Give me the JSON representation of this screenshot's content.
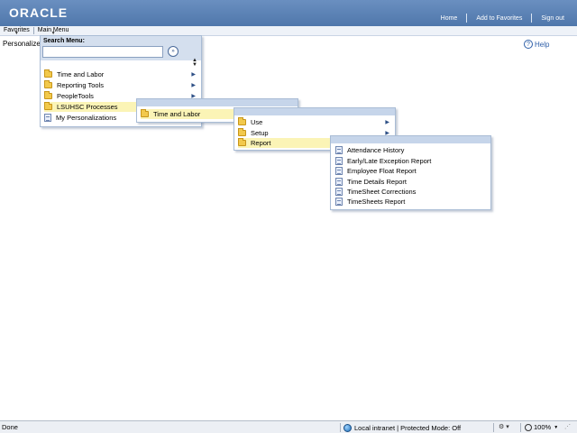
{
  "header": {
    "logo_text": "ORACLE",
    "links": [
      "Home",
      "Add to Favorites",
      "Sign out"
    ],
    "bg_color": "#5b80b4"
  },
  "menubar": {
    "items": [
      "Favorites",
      "Main Menu"
    ]
  },
  "page": {
    "personalize": "Personalize",
    "help": "Help"
  },
  "main_menu": {
    "search_label": "Search Menu:",
    "search_value": "",
    "go_icon": "double-chevron-right-icon",
    "items": [
      "Time and Labor",
      "Reporting Tools",
      "PeopleTools",
      "LSUHSC Processes",
      "My Personalizations"
    ]
  },
  "submenu_1": {
    "items": [
      "Time and Labor"
    ]
  },
  "submenu_2": {
    "items": [
      "Use",
      "Setup",
      "Report"
    ]
  },
  "submenu_3": {
    "items": [
      "Attendance History",
      "Early/Late Exception Report",
      "Employee Float Report",
      "Time Details Report",
      "TimeSheet Corrections",
      "TimeSheets Report"
    ]
  },
  "statusbar": {
    "done": "Done",
    "zone": "Local intranet | Protected Mode: Off",
    "zoom": "100%"
  },
  "colors": {
    "selected_item": "#fbf4b6",
    "panel_title": "#c6d5ea",
    "link_blue": "#2d5ea8"
  }
}
